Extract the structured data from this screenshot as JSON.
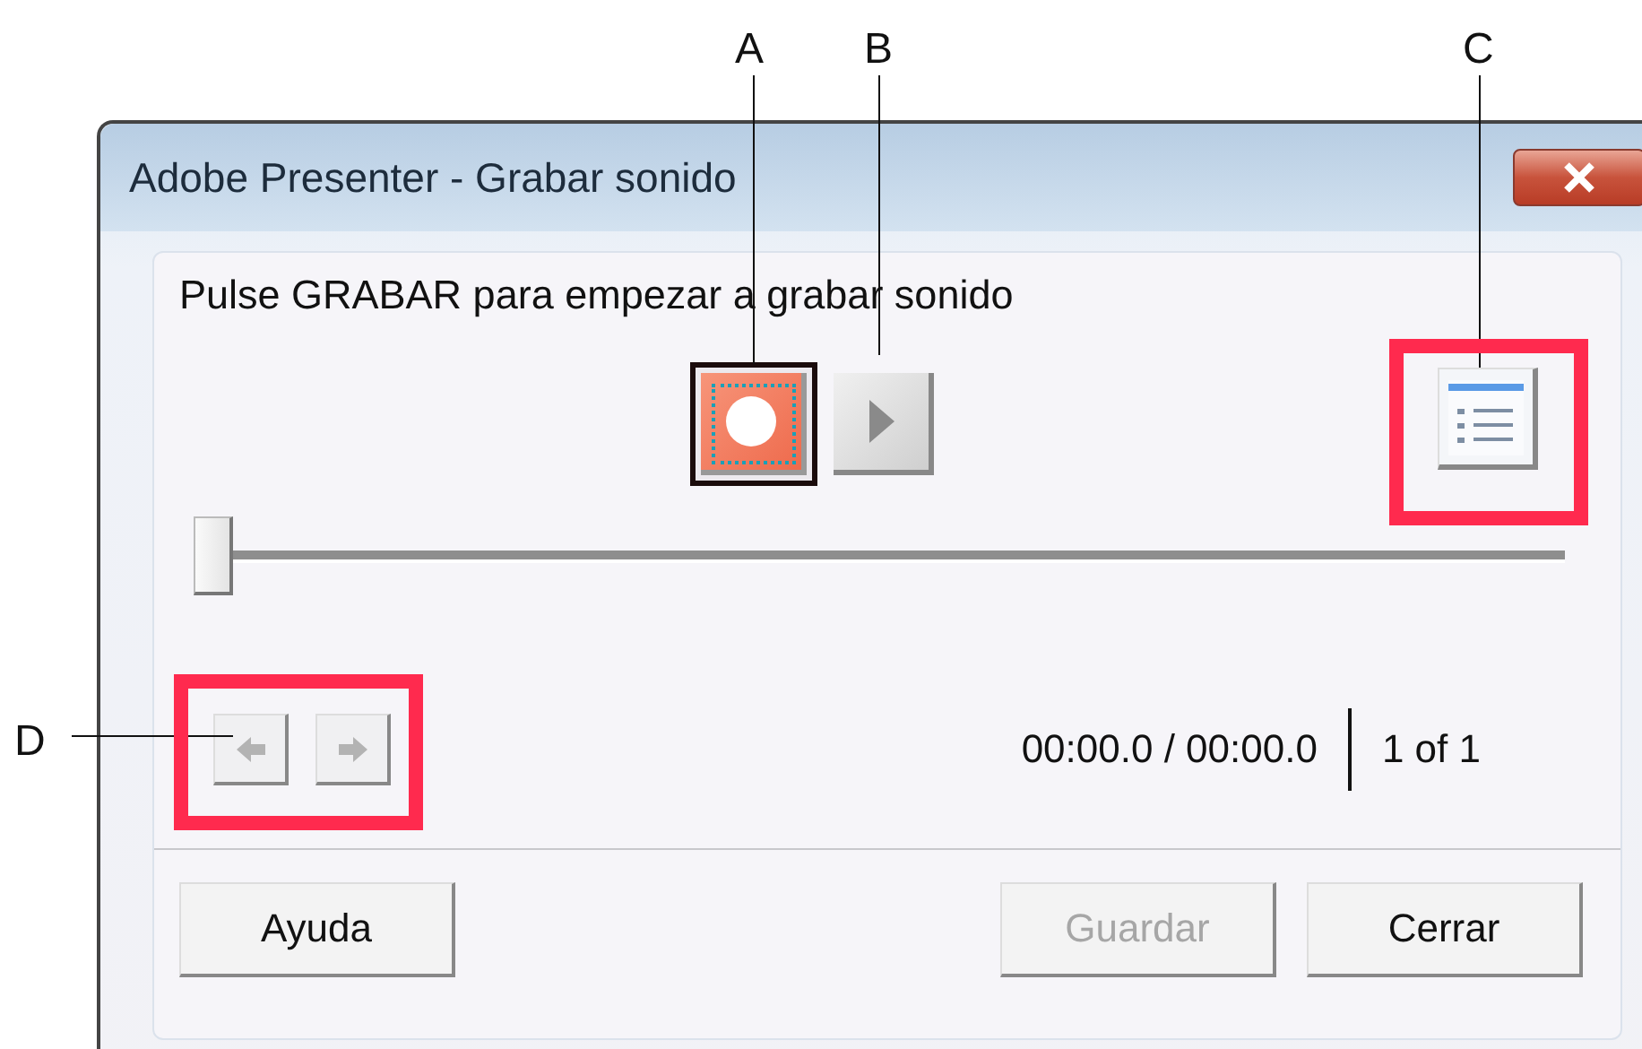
{
  "window": {
    "title": "Adobe Presenter - Grabar sonido"
  },
  "instruction": "Pulse GRABAR para empezar a grabar sonido",
  "transport": [
    {
      "kind": "record",
      "focused": true
    },
    {
      "kind": "play",
      "focused": false
    }
  ],
  "slider": {
    "level": 0
  },
  "nav": [
    {
      "kind": "back",
      "disabled": true
    },
    {
      "kind": "forward",
      "disabled": true
    }
  ],
  "time": "00:00.0 / 00:00.0",
  "counter": "1 of 1",
  "buttons": [
    {
      "label": "Ayuda",
      "disabled": false
    },
    {
      "label": "Guardar",
      "disabled": true
    },
    {
      "label": "Cerrar",
      "disabled": false
    }
  ],
  "callouts": [
    {
      "label": "A"
    },
    {
      "label": "B"
    },
    {
      "label": "C",
      "framed": true
    },
    {
      "label": "D",
      "framed": true
    }
  ]
}
